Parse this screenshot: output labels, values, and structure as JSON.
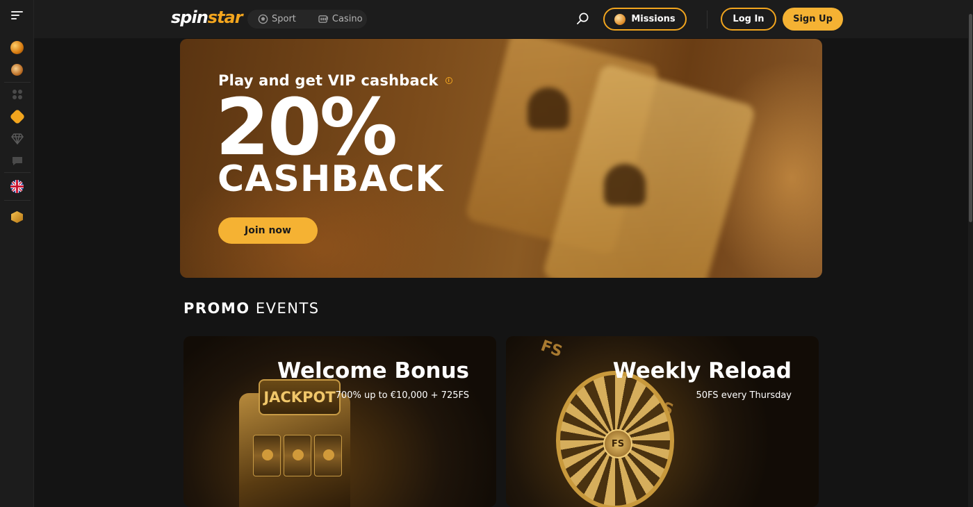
{
  "header": {
    "logo_part1": "spin",
    "logo_part2": "star",
    "nav": [
      {
        "label": "Sport",
        "icon": "soccer-ball-icon"
      },
      {
        "label": "Casino",
        "icon": "slot-machine-icon"
      }
    ],
    "missions_label": "Missions",
    "login_label": "Log In",
    "signup_label": "Sign Up"
  },
  "sidebar": {
    "items": [
      {
        "icon": "fortune-orb-icon"
      },
      {
        "icon": "cookie-orb-icon"
      },
      {
        "icon": "grid-dots-icon"
      },
      {
        "icon": "promo-badge-icon"
      },
      {
        "icon": "diamond-icon"
      },
      {
        "icon": "chat-icon"
      },
      {
        "icon": "uk-flag-icon"
      },
      {
        "icon": "gift-cube-icon"
      }
    ]
  },
  "hero": {
    "subtitle": "Play and get VIP cashback",
    "big_value": "20%",
    "big_label": "CASHBACK",
    "cta_label": "Join now"
  },
  "promo": {
    "title_bold": "PROMO",
    "title_rest": "EVENTS",
    "cards": [
      {
        "title": "Welcome Bonus",
        "subtitle": "700% up to €10,000 + 725FS",
        "art_text": "JACKPOT"
      },
      {
        "title": "Weekly Reload",
        "subtitle": "50FS every Thursday",
        "art_text": "FS"
      }
    ]
  },
  "colors": {
    "accent": "#f5b233",
    "background": "#141414",
    "panel": "#1c1c1c"
  }
}
